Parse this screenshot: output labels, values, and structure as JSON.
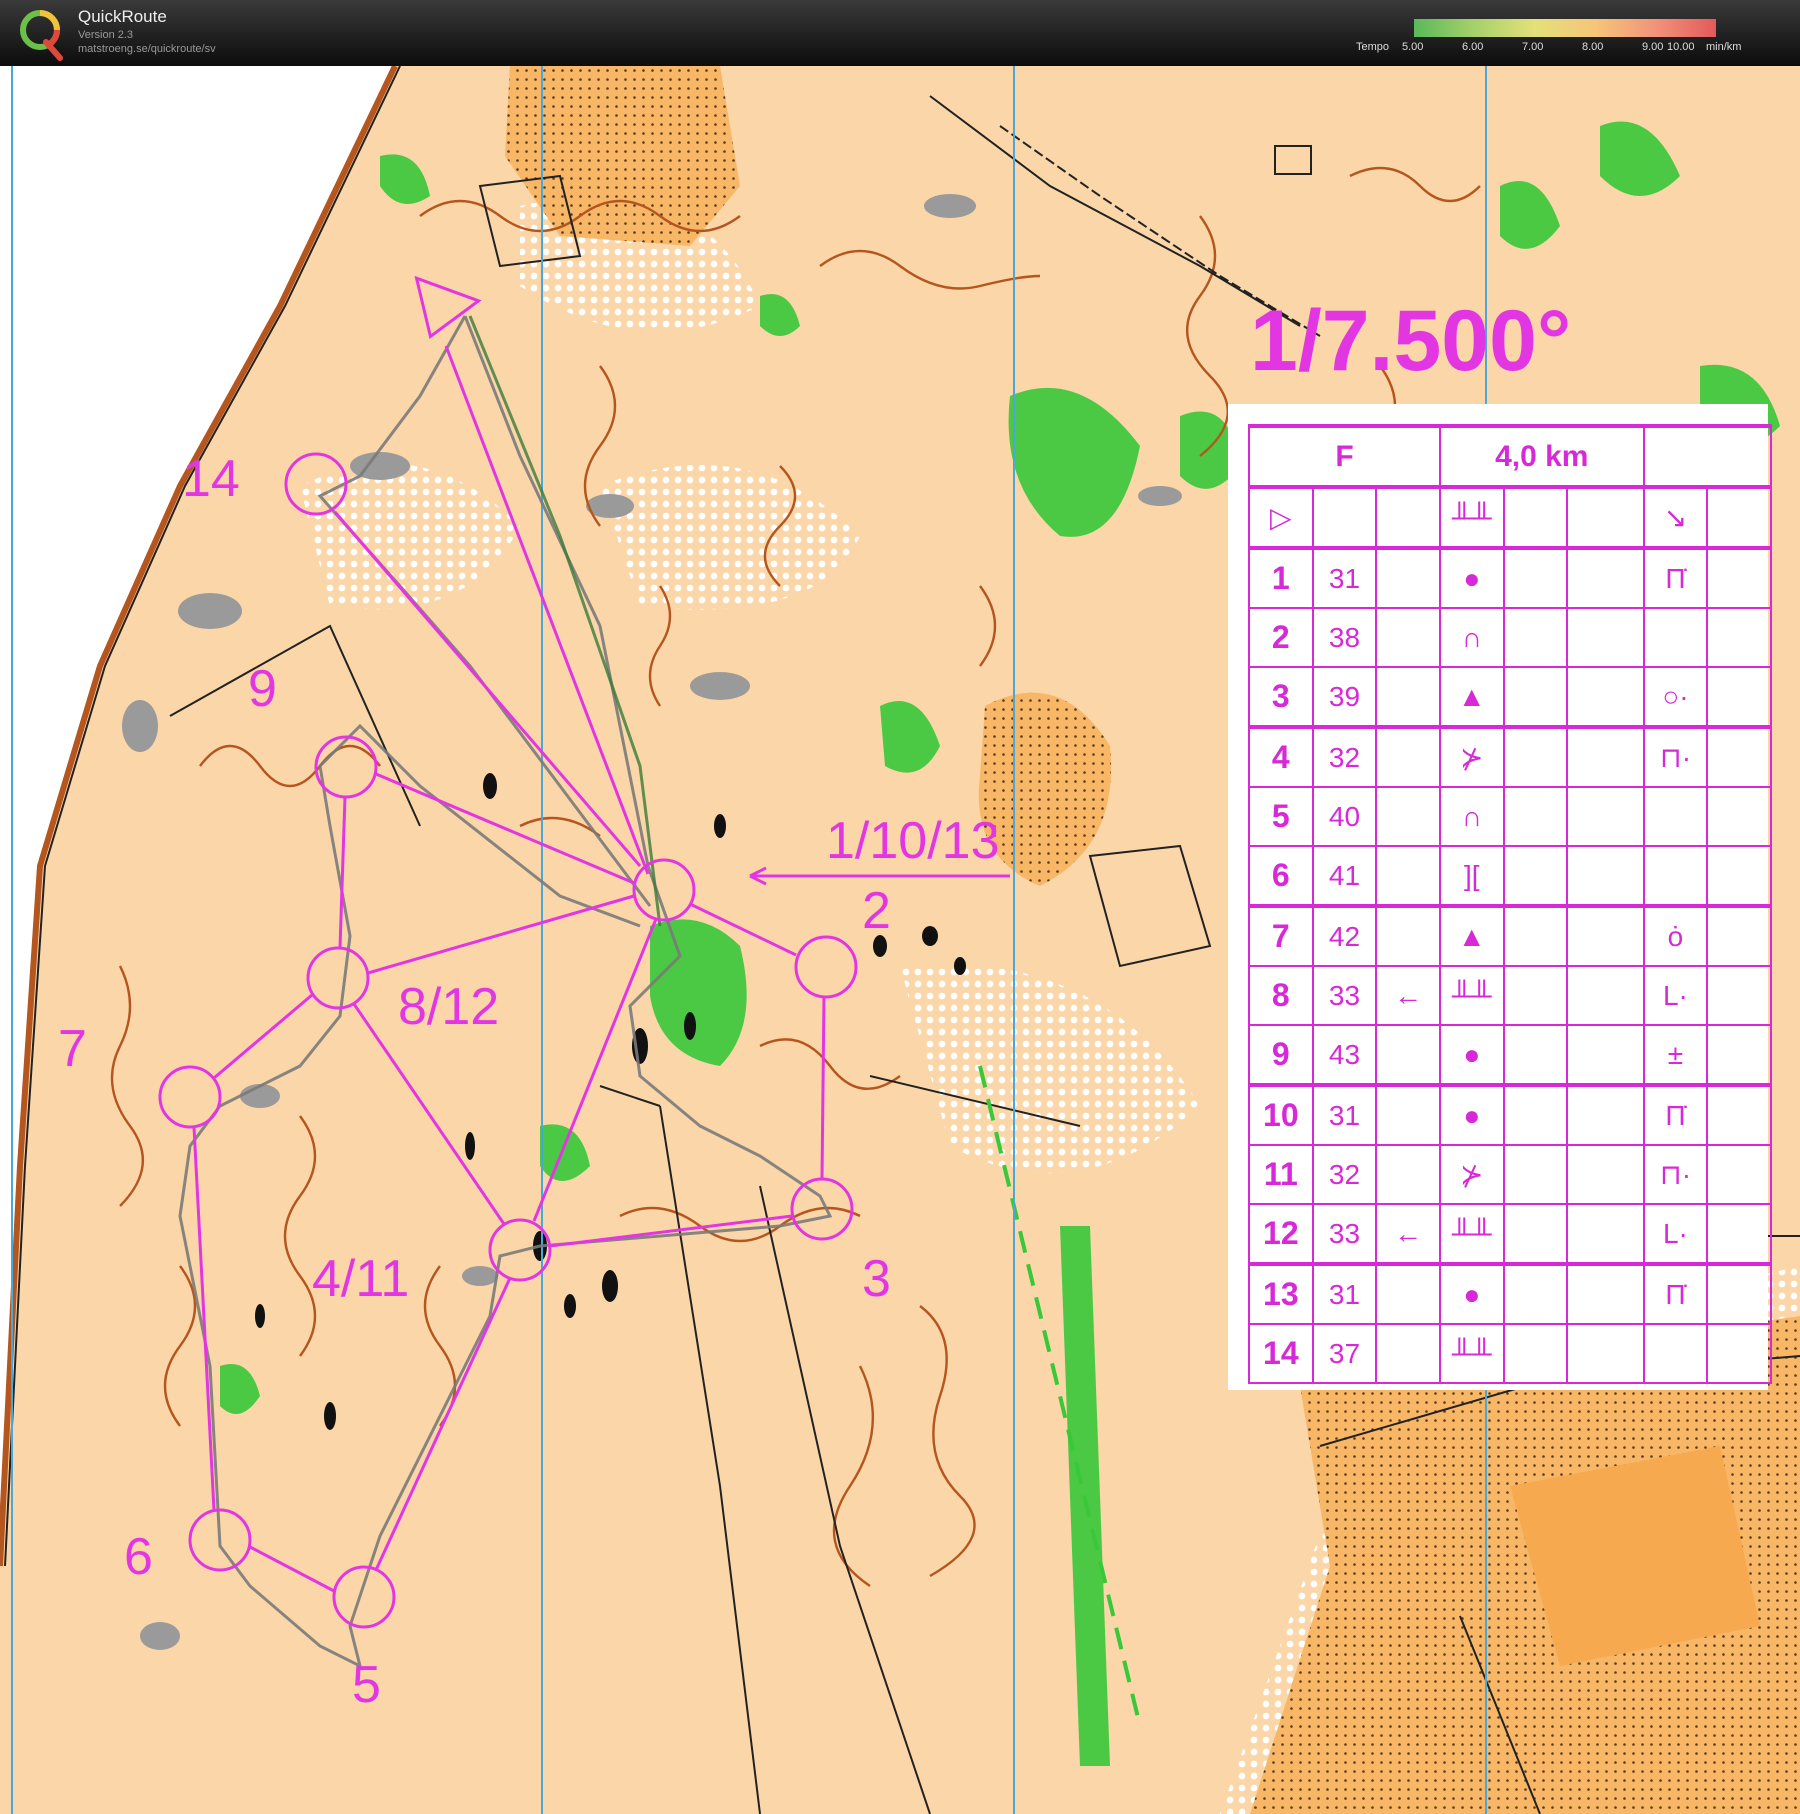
{
  "header": {
    "app_title": "QuickRoute",
    "version": "Version 2.3",
    "url": "matstroeng.se/quickroute/sv",
    "tempo": {
      "label": "Tempo",
      "ticks": [
        "5.00",
        "6.00",
        "7.00",
        "8.00",
        "9.00",
        "10.00"
      ],
      "unit": "min/km",
      "colors": [
        "#5bb85b",
        "#a6d06b",
        "#e4e07a",
        "#f6c57a",
        "#f2937a",
        "#e25a5a"
      ]
    }
  },
  "map": {
    "scale_text": "1/7.500°",
    "control_labels": [
      "14",
      "9",
      "1/10/13",
      "2",
      "8/12",
      "7",
      "3",
      "4/11",
      "6",
      "5"
    ],
    "colors": {
      "course": "#e336e3",
      "open_land": "#fbd6a8",
      "rough_open": "#f7a950",
      "green": "#38c838",
      "contour": "#b5561f",
      "north_lines": "#4aa8d8"
    }
  },
  "control_descriptions": {
    "class": "F",
    "length": "4,0 km",
    "start_symbol": "▷",
    "rows": [
      {
        "n": "1",
        "code": "31",
        "c": "",
        "d": "●",
        "g": "Π̇"
      },
      {
        "n": "2",
        "code": "38",
        "c": "",
        "d": "∩",
        "g": ""
      },
      {
        "n": "3",
        "code": "39",
        "c": "",
        "d": "▲",
        "g": "○·"
      },
      {
        "n": "4",
        "code": "32",
        "c": "",
        "d": "⊁",
        "g": "⊓·"
      },
      {
        "n": "5",
        "code": "40",
        "c": "",
        "d": "∩",
        "g": ""
      },
      {
        "n": "6",
        "code": "41",
        "c": "",
        "d": "][",
        "g": ""
      },
      {
        "n": "7",
        "code": "42",
        "c": "",
        "d": "▲",
        "g": "ȯ"
      },
      {
        "n": "8",
        "code": "33",
        "c": "←",
        "d": "╨╨",
        "g": "L·"
      },
      {
        "n": "9",
        "code": "43",
        "c": "",
        "d": "●",
        "g": "±"
      },
      {
        "n": "10",
        "code": "31",
        "c": "",
        "d": "●",
        "g": "Π̇"
      },
      {
        "n": "11",
        "code": "32",
        "c": "",
        "d": "⊁",
        "g": "⊓·"
      },
      {
        "n": "12",
        "code": "33",
        "c": "←",
        "d": "╨╨",
        "g": "L·"
      },
      {
        "n": "13",
        "code": "31",
        "c": "",
        "d": "●",
        "g": "Π̇"
      },
      {
        "n": "14",
        "code": "37",
        "c": "",
        "d": "╨╨",
        "g": ""
      }
    ]
  }
}
